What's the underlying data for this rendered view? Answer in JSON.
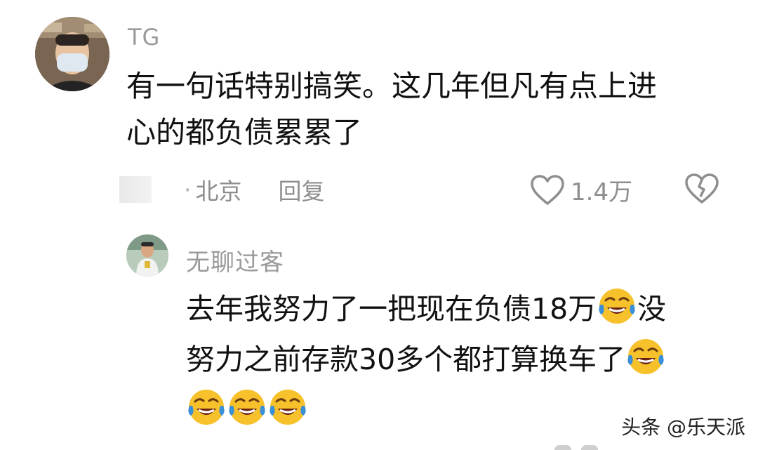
{
  "comment": {
    "username": "TG",
    "text_lines": [
      "有一句话特别搞笑。这几年但凡有点上进",
      "心的都负债累累了"
    ],
    "meta": {
      "separator": "·",
      "location": "北京",
      "reply_label": "回复"
    },
    "likes": "1.4万",
    "icons": {
      "like": "heart-outline-icon",
      "dislike": "broken-heart-icon"
    }
  },
  "reply": {
    "username": "无聊过客",
    "line1_a": "去年我努力了一把现在负债18万",
    "line1_b": "没",
    "line2": "努力之前存款30多个都打算换车了",
    "emoji": "laughing-crying-emoji"
  },
  "watermark": "头条 @乐天派",
  "colors": {
    "username": "#9a9a9a",
    "text": "#111111",
    "meta": "#8e8e8e",
    "emoji_face": "#f6c12b",
    "emoji_tears": "#3a8fd9"
  }
}
